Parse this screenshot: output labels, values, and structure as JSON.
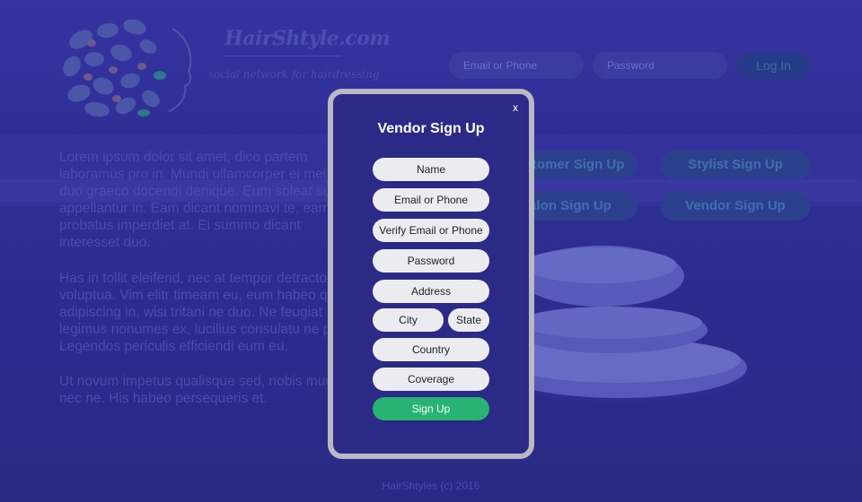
{
  "brand": {
    "name": "HairShtyle.com",
    "tagline": "social network for hairdressing"
  },
  "header": {
    "email_placeholder": "Email or Phone",
    "password_placeholder": "Password",
    "login_label": "Log In"
  },
  "intro": {
    "p1": "Lorem ipsum dolor sit amet, dico partem laboramus pro in. Mundi ullamcorper ei mei, in duo graeco docendi denique. Eum soleat suscipit appellantur in. Eam dicant nominavi te, eam probatus imperdiet at. Ei summo dicant interesset duo.",
    "p2": "Has in tollit eleifend, nec at tempor detracto voluptua. Vim elitr timeam eu, eum habeo quodsi adipiscing in, wisi tritani ne duo. Ne feugiat legimus nonumes ex, lucilius consulatu ne per. Legendos periculis efficiendi eum eu.",
    "p3": "Ut novum impetus qualisque sed, nobis mucius nec ne. His habeo persequeris et."
  },
  "roles": {
    "customer": "Customer Sign Up",
    "stylist": "Stylist Sign Up",
    "salon": "Salon Sign Up",
    "vendor": "Vendor Sign Up"
  },
  "modal": {
    "close": "x",
    "title": "Vendor Sign Up",
    "fields": {
      "name": "Name",
      "email": "Email or Phone",
      "verify": "Verify Email or Phone",
      "password": "Password",
      "address": "Address",
      "city": "City",
      "state": "State",
      "country": "Country",
      "coverage": "Coverage"
    },
    "submit": "Sign Up"
  },
  "footer": "HairShtyles (c) 2016",
  "colors": {
    "overlay": "#2b2a86",
    "accent": "#27b371",
    "modal_border": "#b9b9c4"
  }
}
